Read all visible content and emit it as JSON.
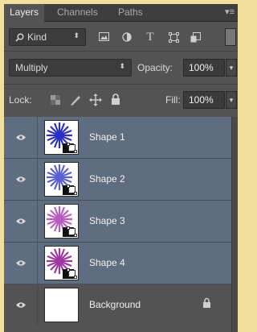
{
  "panel": {
    "tabs": [
      {
        "label": "Layers",
        "active": true
      },
      {
        "label": "Channels",
        "active": false
      },
      {
        "label": "Paths",
        "active": false
      }
    ],
    "menu_icon": "panel-menu-icon"
  },
  "filter": {
    "kind_label": "Kind",
    "icons": [
      "pixel-filter-icon",
      "adjustment-filter-icon",
      "type-filter-icon",
      "shape-filter-icon",
      "smart-object-filter-icon"
    ]
  },
  "blend": {
    "mode": "Multiply",
    "opacity_label": "Opacity:",
    "opacity_value": "100%"
  },
  "lock": {
    "label": "Lock:",
    "fill_label": "Fill:",
    "fill_value": "100%",
    "icons": [
      "lock-transparent-icon",
      "lock-image-icon",
      "lock-position-icon",
      "lock-all-icon"
    ]
  },
  "layers": [
    {
      "name": "Shape 1",
      "visible": true,
      "selected": true,
      "thumb_colors": [
        "#2c2fc4",
        "#4a52d6"
      ]
    },
    {
      "name": "Shape 2",
      "visible": true,
      "selected": true,
      "thumb_colors": [
        "#3d4fd0",
        "#8a7fd8"
      ]
    },
    {
      "name": "Shape 3",
      "visible": true,
      "selected": true,
      "thumb_colors": [
        "#b150b8",
        "#d07fd0"
      ]
    },
    {
      "name": "Shape 4",
      "visible": true,
      "selected": true,
      "thumb_colors": [
        "#9a2f9e",
        "#c46fc4"
      ]
    },
    {
      "name": "Background",
      "visible": true,
      "selected": false,
      "locked": true
    }
  ],
  "colors": {
    "panel_bg": "#535353",
    "selected_layer": "#5e6e80",
    "outer_bg": "#f2df9e"
  }
}
